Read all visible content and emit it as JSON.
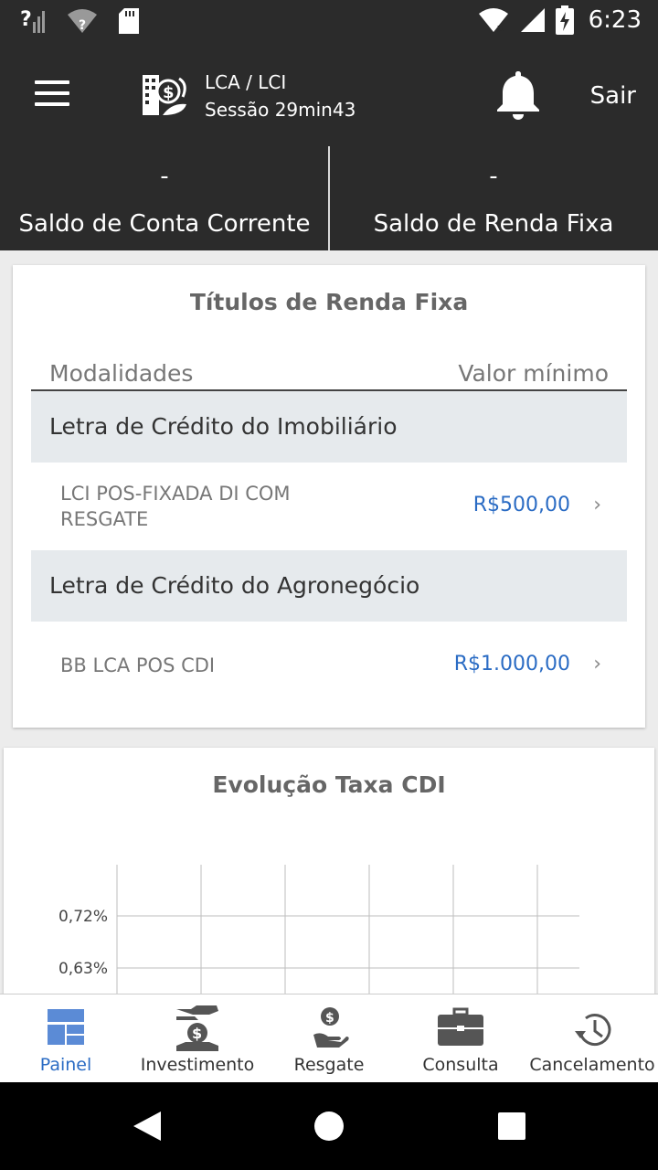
{
  "status_bar": {
    "time": "6:23"
  },
  "app_bar": {
    "title": "LCA / LCI",
    "session": "Sessão 29min43",
    "logout_label": "Sair"
  },
  "balances": [
    {
      "value": "-",
      "label": "Saldo de Conta Corrente"
    },
    {
      "value": "-",
      "label": "Saldo de Renda Fixa"
    }
  ],
  "fixed_income": {
    "title": "Títulos de Renda Fixa",
    "col_modalities": "Modalidades",
    "col_min_value": "Valor mínimo",
    "groups": [
      {
        "name": "Letra de Crédito do Imobiliário",
        "items": [
          {
            "name": "LCI POS-FIXADA DI COM RESGATE",
            "value": "R$500,00"
          }
        ]
      },
      {
        "name": "Letra de Crédito do Agronegócio",
        "items": [
          {
            "name": "BB LCA POS CDI",
            "value": "R$1.000,00"
          }
        ]
      }
    ]
  },
  "cdi_chart": {
    "title": "Evolução Taxa CDI",
    "y_tick_labels": [
      "0,72%",
      "0,63%"
    ]
  },
  "chart_data": {
    "type": "line",
    "title": "Evolução Taxa CDI",
    "y_ticks": [
      0.72,
      0.63
    ],
    "y_tick_labels": [
      "0,72%",
      "0,63%"
    ],
    "grid": true,
    "series": []
  },
  "bottom_nav": [
    {
      "label": "Painel",
      "icon": "dashboard-icon",
      "active": true
    },
    {
      "label": "Investimento",
      "icon": "invest-icon",
      "active": false
    },
    {
      "label": "Resgate",
      "icon": "redeem-icon",
      "active": false
    },
    {
      "label": "Consulta",
      "icon": "briefcase-icon",
      "active": false
    },
    {
      "label": "Cancelamento",
      "icon": "history-icon",
      "active": false
    }
  ],
  "colors": {
    "header_bg": "#2b2b2b",
    "accent_blue": "#2b6cc4",
    "group_bg": "#e6eaed"
  }
}
